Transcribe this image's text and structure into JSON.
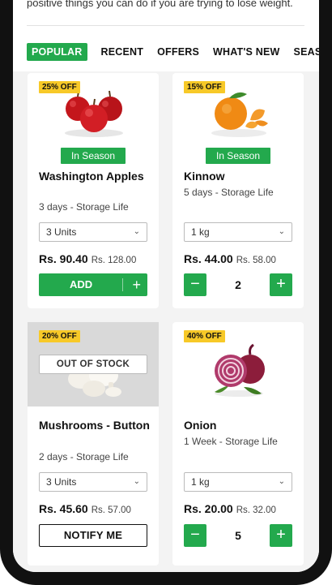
{
  "intro": {
    "text": "positive things you can do if you are trying to lose weight."
  },
  "tabs": [
    {
      "label": "POPULAR",
      "active": true
    },
    {
      "label": "RECENT",
      "active": false
    },
    {
      "label": "OFFERS",
      "active": false
    },
    {
      "label": "WHAT'S NEW",
      "active": false
    },
    {
      "label": "SEASO",
      "active": false
    }
  ],
  "products": [
    {
      "discount": "25% OFF",
      "season_label": "In Season",
      "name": "Washington Apples",
      "storage_life": "3 days - Storage Life",
      "unit": "3 Units",
      "price": "Rs. 90.40",
      "mrp": "Rs. 128.00",
      "action_label": "ADD",
      "image": "apples-image"
    },
    {
      "discount": "15% OFF",
      "season_label": "In Season",
      "name": "Kinnow",
      "storage_life": "5 days - Storage Life",
      "unit": "1 kg",
      "price": "Rs. 44.00",
      "mrp": "Rs. 58.00",
      "quantity": "2",
      "image": "kinnow-image"
    },
    {
      "discount": "20% OFF",
      "status": "OUT OF STOCK",
      "name": "Mushrooms - Button",
      "storage_life": "2 days - Storage Life",
      "unit": "3 Units",
      "price": "Rs. 45.60",
      "mrp": "Rs. 57.00",
      "action_label": "NOTIFY ME",
      "image": "mushrooms-image"
    },
    {
      "discount": "40% OFF",
      "name": "Onion",
      "storage_life": "1 Week - Storage Life",
      "unit": "1 kg",
      "price": "Rs. 20.00",
      "mrp": "Rs. 32.00",
      "quantity": "5",
      "image": "onion-image"
    }
  ],
  "colors": {
    "accent_green": "#23a94d",
    "badge_yellow": "#f7c928",
    "page_bg": "#f3f3f3"
  },
  "icons": {
    "dropdown": "chevron-down-icon",
    "add": "plus-icon",
    "decrement": "minus-icon",
    "increment": "plus-icon"
  }
}
